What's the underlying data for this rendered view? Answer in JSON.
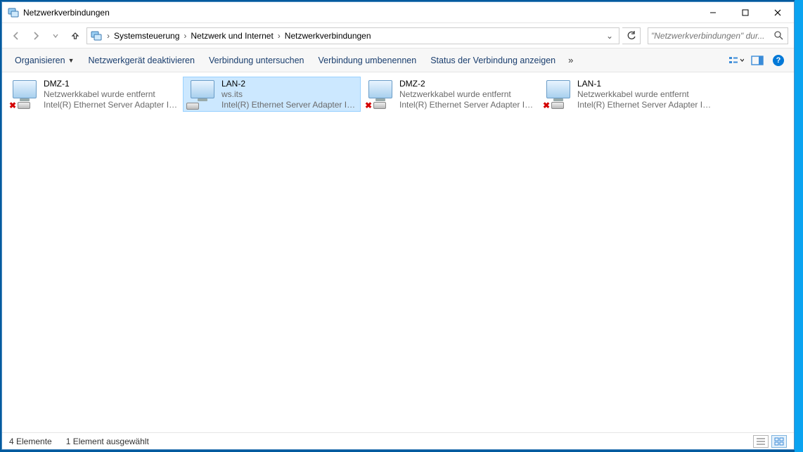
{
  "window": {
    "title": "Netzwerkverbindungen"
  },
  "nav": {
    "crumbs": [
      "Systemsteuerung",
      "Netzwerk und Internet",
      "Netzwerkverbindungen"
    ],
    "search_placeholder": "\"Netzwerkverbindungen\" dur..."
  },
  "toolbar": {
    "organize": "Organisieren",
    "deactivate": "Netzwerkgerät deaktivieren",
    "diagnose": "Verbindung untersuchen",
    "rename": "Verbindung umbenennen",
    "status": "Status der Verbindung anzeigen",
    "overflow": "»"
  },
  "items": [
    {
      "name": "DMZ-1",
      "status": "Netzwerkkabel wurde entfernt",
      "adapter": "Intel(R) Ethernet Server Adapter I3...",
      "selected": false,
      "disconnected": true
    },
    {
      "name": "LAN-2",
      "status": "ws.its",
      "adapter": "Intel(R) Ethernet Server Adapter I3...",
      "selected": true,
      "disconnected": false
    },
    {
      "name": "DMZ-2",
      "status": "Netzwerkkabel wurde entfernt",
      "adapter": "Intel(R) Ethernet Server Adapter I3...",
      "selected": false,
      "disconnected": true
    },
    {
      "name": "LAN-1",
      "status": "Netzwerkkabel wurde entfernt",
      "adapter": "Intel(R) Ethernet Server Adapter I3...",
      "selected": false,
      "disconnected": true
    }
  ],
  "statusbar": {
    "count": "4 Elemente",
    "selection": "1 Element ausgewählt"
  }
}
